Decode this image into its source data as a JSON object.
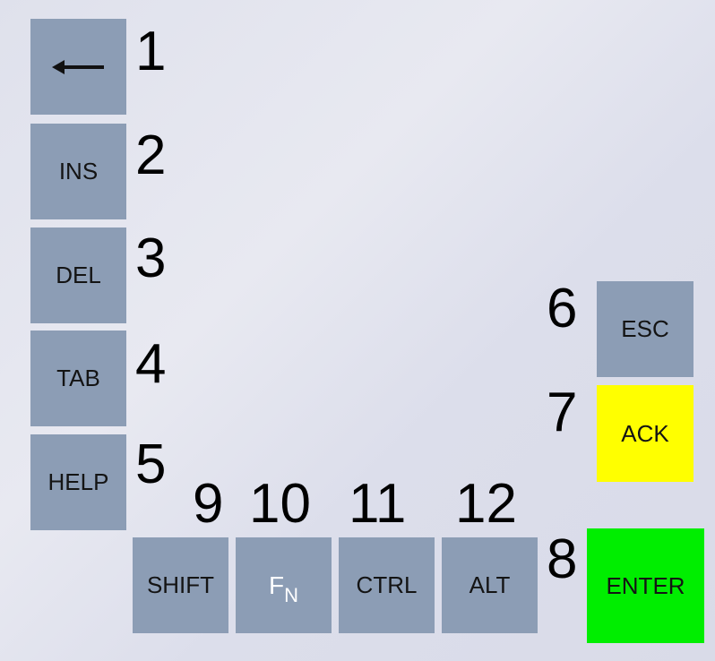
{
  "left_column": [
    {
      "id": "backspace",
      "number": "1",
      "label": "",
      "icon": "left-arrow-icon"
    },
    {
      "id": "ins",
      "number": "2",
      "label": "INS"
    },
    {
      "id": "del",
      "number": "3",
      "label": "DEL"
    },
    {
      "id": "tab",
      "number": "4",
      "label": "TAB"
    },
    {
      "id": "help",
      "number": "5",
      "label": "HELP"
    }
  ],
  "right_column": [
    {
      "id": "esc",
      "number": "6",
      "label": "ESC"
    },
    {
      "id": "ack",
      "number": "7",
      "label": "ACK",
      "color": "#ffff00"
    },
    {
      "id": "enter",
      "number": "8",
      "label": "ENTER",
      "color": "#00ee00"
    }
  ],
  "bottom_row": [
    {
      "id": "shift",
      "number": "9",
      "label": "SHIFT"
    },
    {
      "id": "fn",
      "number": "10",
      "label": "F",
      "label_sub": "N"
    },
    {
      "id": "ctrl",
      "number": "11",
      "label": "CTRL"
    },
    {
      "id": "alt",
      "number": "12",
      "label": "ALT"
    }
  ],
  "colors": {
    "key_default": "#8c9db5",
    "ack": "#ffff00",
    "enter": "#00ee00",
    "background": "#e2e4ee"
  }
}
